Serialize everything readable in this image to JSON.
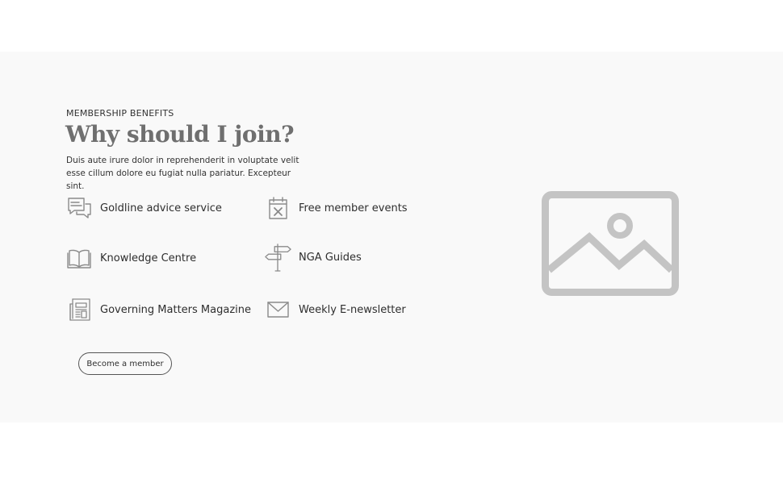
{
  "section": {
    "eyebrow": "MEMBERSHIP BENEFITS",
    "title": "Why should I join?",
    "intro": "Duis aute irure dolor in reprehenderit in voluptate velit esse cillum dolore eu fugiat nulla pariatur. Excepteur sint."
  },
  "benefits": [
    {
      "label": "Goldline advice service",
      "icon": "chat-bubbles-icon"
    },
    {
      "label": "Free member events",
      "icon": "calendar-x-icon"
    },
    {
      "label": "Knowledge Centre",
      "icon": "open-book-icon"
    },
    {
      "label": "NGA Guides",
      "icon": "signpost-icon"
    },
    {
      "label": "Governing Matters Magazine",
      "icon": "newspaper-icon"
    },
    {
      "label": "Weekly E-newsletter",
      "icon": "envelope-icon"
    }
  ],
  "cta": {
    "label": "Become a member"
  },
  "colors": {
    "section_bg": "#f9f9f9",
    "title": "#6f6f6f",
    "icon": "#8a8a8a",
    "placeholder": "#c4c4c4"
  }
}
